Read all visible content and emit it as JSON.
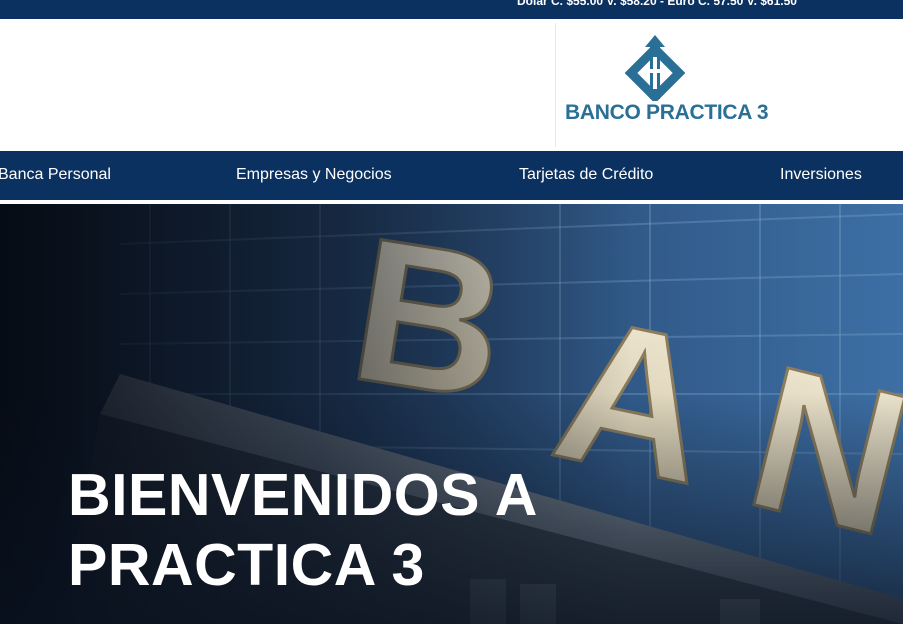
{
  "topbar": {
    "rates_text": "Dolar C. $55.00 V. $58.20 - Euro C. 57.50 V. $61.50"
  },
  "header": {
    "logo_text": "BANCO PRACTICA 3",
    "logo_icon": "bank-logo-icon",
    "brand_color": "#2a6f96"
  },
  "nav": {
    "items": [
      {
        "label": "Banca Personal"
      },
      {
        "label": "Empresas y Negocios"
      },
      {
        "label": "Tarjetas de Crédito"
      },
      {
        "label": "Inversiones"
      }
    ],
    "background": "#0b3160"
  },
  "hero": {
    "title_line1": "BIENVENIDOS A",
    "title_line2": "PRACTICA 3",
    "sign_letters": [
      "B",
      "A",
      "N"
    ]
  }
}
